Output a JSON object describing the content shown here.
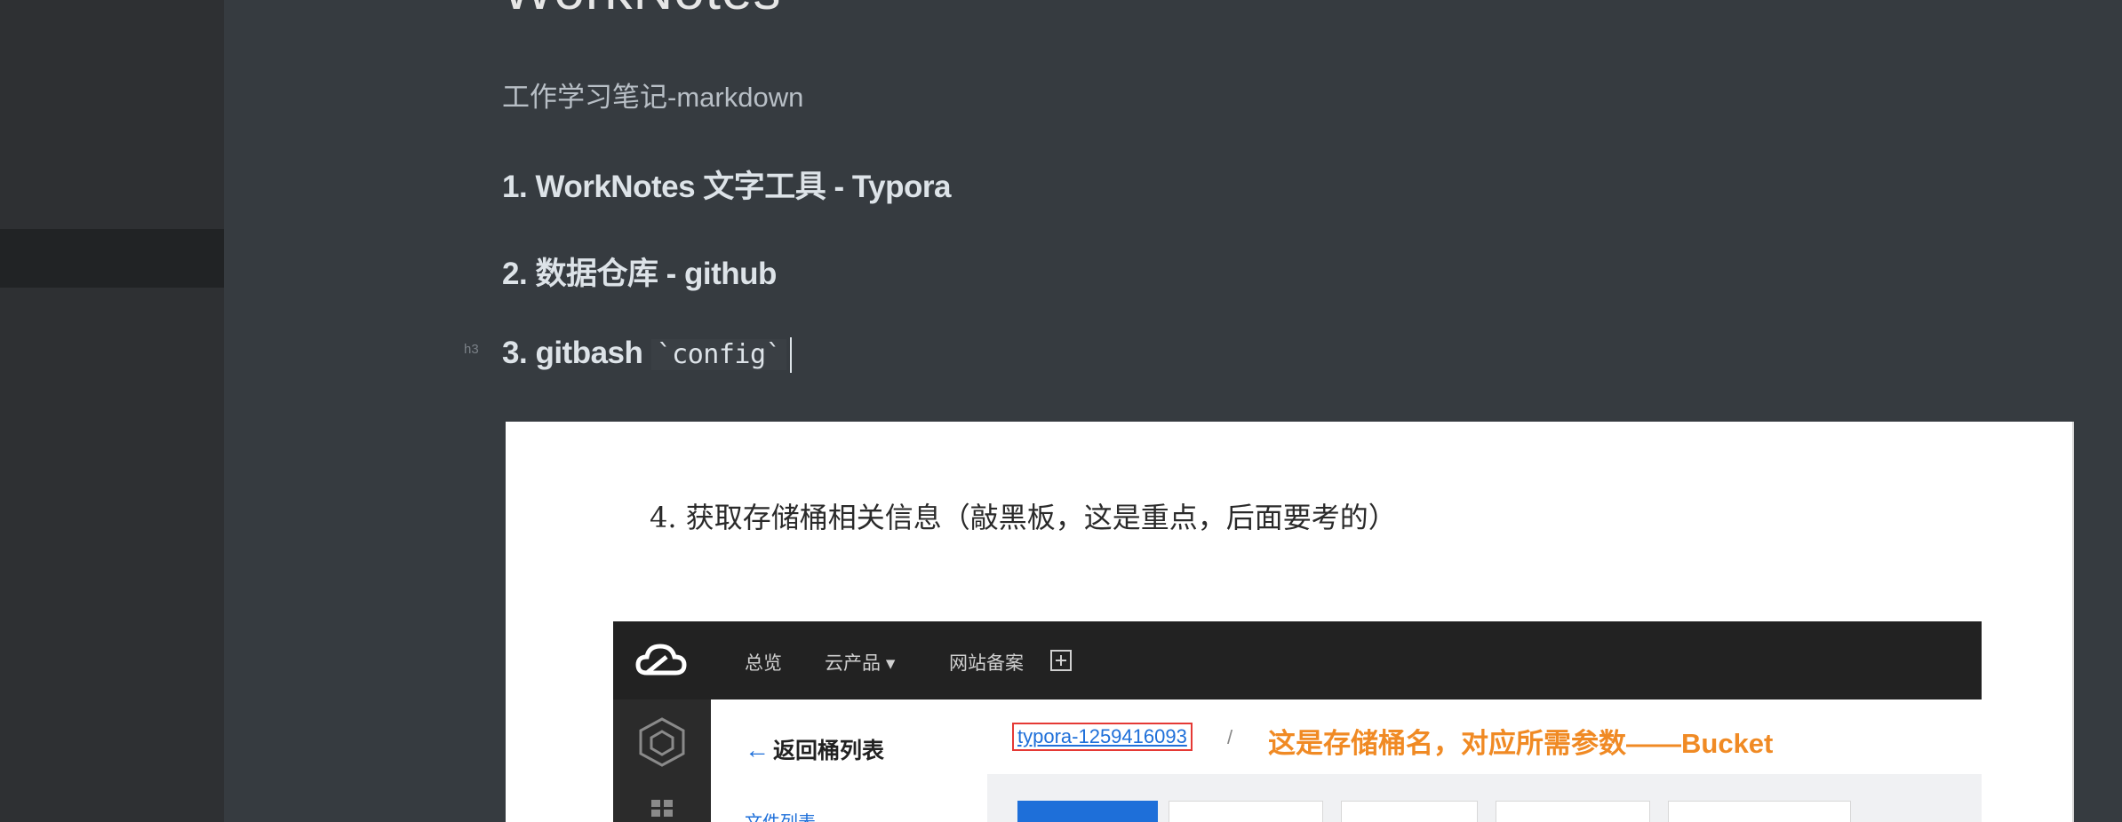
{
  "document": {
    "title": "WorkNotes",
    "subtitle": "工作学习笔记-markdown",
    "headings": [
      {
        "number": "1.",
        "text": "WorkNotes 文字工具 - Typora"
      },
      {
        "number": "2.",
        "text": "数据仓库 - github"
      },
      {
        "number": "3.",
        "text": "gitbash",
        "code": "`config`"
      }
    ],
    "heading_marker": "h3"
  },
  "embedded_image": {
    "heading": "4. 获取存储桶相关信息（敲黑板，这是重点，后面要考的）",
    "console": {
      "top_nav": [
        "总览",
        "云产品 ▾",
        "网站备案"
      ],
      "back_link": "返回桶列表",
      "file_list": "文件列表",
      "bucket_name": "typora-1259416093",
      "separator": "/",
      "annotation": "这是存储桶名，对应所需参数——Bucket"
    }
  },
  "colors": {
    "editor_bg": "#363b40",
    "sidebar_bg": "#2e3033",
    "text": "#b8bfc6",
    "annotation": "#f08a24",
    "link": "#1e6fd9",
    "highlight_border": "#e53935"
  }
}
